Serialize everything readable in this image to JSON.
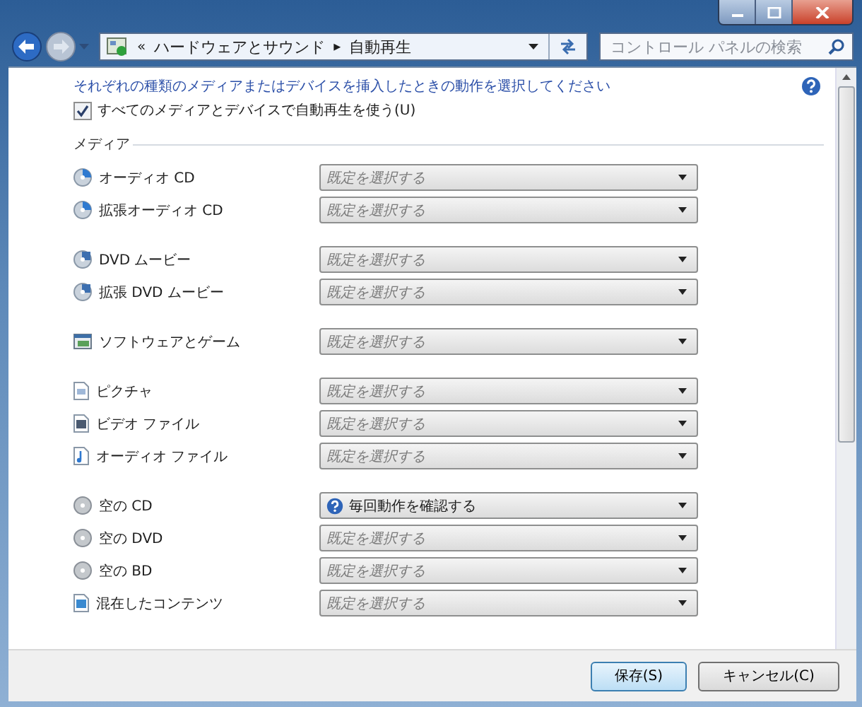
{
  "address_bar": {
    "crumbs": [
      {
        "text": "«",
        "kind": "sep"
      },
      {
        "text": "ハードウェアとサウンド",
        "kind": "crumb"
      },
      {
        "text": "▸",
        "kind": "sep"
      },
      {
        "text": "自動再生",
        "kind": "crumb"
      }
    ]
  },
  "search": {
    "placeholder": "コントロール パネルの検索"
  },
  "instruction": "それぞれの種類のメディアまたはデバイスを挿入したときの動作を選択してください",
  "autoplay_checkbox": {
    "label": "すべてのメディアとデバイスで自動再生を使う(U)",
    "checked": true
  },
  "section_title": "メディア",
  "groups": [
    [
      {
        "label": "オーディオ CD",
        "kind": "cd",
        "action": {
          "placeholder": "既定を選択する"
        }
      },
      {
        "label": "拡張オーディオ CD",
        "kind": "cd",
        "action": {
          "placeholder": "既定を選択する"
        }
      }
    ],
    [
      {
        "label": "DVD ムービー",
        "kind": "dvd",
        "action": {
          "placeholder": "既定を選択する"
        }
      },
      {
        "label": "拡張 DVD ムービー",
        "kind": "dvd",
        "action": {
          "placeholder": "既定を選択する"
        }
      }
    ],
    [
      {
        "label": "ソフトウェアとゲーム",
        "kind": "software",
        "action": {
          "placeholder": "既定を選択する"
        }
      }
    ],
    [
      {
        "label": "ピクチャ",
        "kind": "picture",
        "action": {
          "placeholder": "既定を選択する"
        }
      },
      {
        "label": "ビデオ ファイル",
        "kind": "video",
        "action": {
          "placeholder": "既定を選択する"
        }
      },
      {
        "label": "オーディオ ファイル",
        "kind": "audio",
        "action": {
          "placeholder": "既定を選択する"
        }
      }
    ],
    [
      {
        "label": "空の CD",
        "kind": "blank",
        "action": {
          "value": "毎回動作を確認する",
          "kind": "ask"
        }
      },
      {
        "label": "空の DVD",
        "kind": "blank",
        "action": {
          "placeholder": "既定を選択する"
        }
      },
      {
        "label": "空の BD",
        "kind": "blank",
        "action": {
          "placeholder": "既定を選択する"
        }
      },
      {
        "label": "混在したコンテンツ",
        "kind": "mixed",
        "action": {
          "placeholder": "既定を選択する"
        }
      }
    ]
  ],
  "buttons": [
    {
      "label": "保存(S)",
      "kind": "default"
    },
    {
      "label": "キャンセル(C)",
      "kind": "normal"
    }
  ]
}
